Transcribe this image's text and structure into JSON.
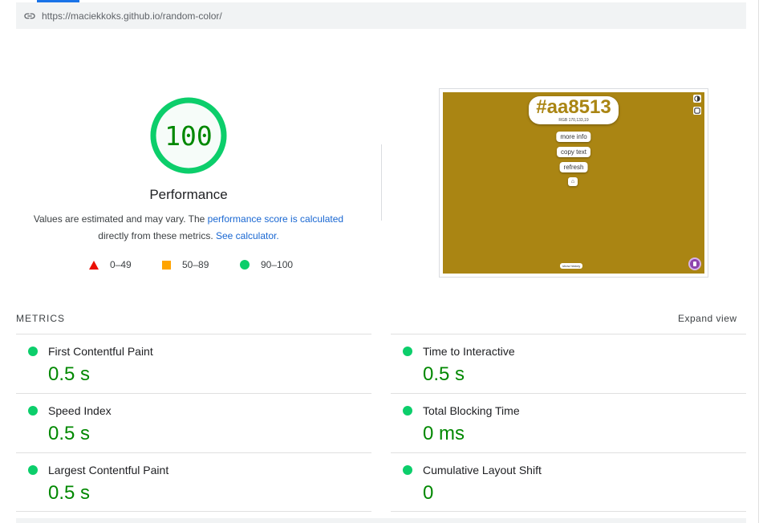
{
  "url_bar": {
    "url": "https://maciekkoks.github.io/random-color/"
  },
  "score": {
    "value": "100",
    "title": "Performance",
    "desc_prefix": "Values are estimated and may vary. The ",
    "desc_link1": "performance score is calculated",
    "desc_middle": " directly from these metrics. ",
    "desc_link2": "See calculator.",
    "gauge_fraction": 1.0
  },
  "legend": [
    {
      "label": "0–49",
      "color": "#eb0f00",
      "shape": "triangle"
    },
    {
      "label": "50–89",
      "color": "#ffa400",
      "shape": "square"
    },
    {
      "label": "90–100",
      "color": "#0cce6b",
      "shape": "circle"
    }
  ],
  "screenshot": {
    "background": "#aa8513",
    "hex": "#aa8513",
    "rgb": "RGB 170,133,19",
    "buttons": [
      "more info",
      "copy text",
      "refresh"
    ],
    "history_label": "show history"
  },
  "metrics": {
    "title": "METRICS",
    "expand_label": "Expand view",
    "items": [
      {
        "label": "First Contentful Paint",
        "value": "0.5 s"
      },
      {
        "label": "Time to Interactive",
        "value": "0.5 s"
      },
      {
        "label": "Speed Index",
        "value": "0.5 s"
      },
      {
        "label": "Total Blocking Time",
        "value": "0 ms"
      },
      {
        "label": "Largest Contentful Paint",
        "value": "0.5 s"
      },
      {
        "label": "Cumulative Layout Shift",
        "value": "0"
      }
    ]
  },
  "colors": {
    "pass": "#0cce6b",
    "pass_text": "#008800",
    "link": "#1967d2",
    "tab_accent": "#1a73e8"
  }
}
